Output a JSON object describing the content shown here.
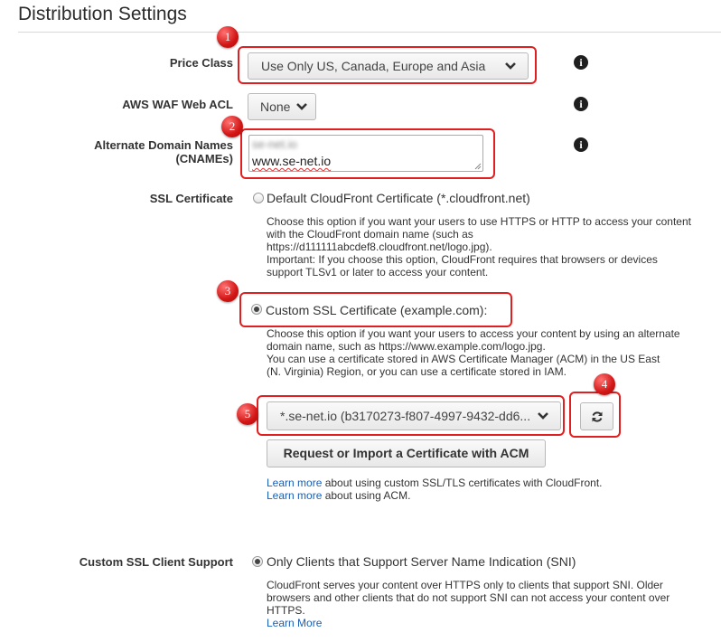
{
  "section": {
    "title": "Distribution Settings"
  },
  "price_class": {
    "label": "Price Class",
    "value": "Use Only US, Canada, Europe and Asia",
    "marker": "1"
  },
  "waf": {
    "label": "AWS WAF Web ACL",
    "value": "None"
  },
  "cnames": {
    "label_line1": "Alternate Domain Names",
    "label_line2": "(CNAMEs)",
    "line1": "se-net.io",
    "line2": "www.se-net.io",
    "marker": "2"
  },
  "ssl": {
    "label": "SSL Certificate",
    "default_option": "Default CloudFront Certificate (*.cloudfront.net)",
    "default_desc": [
      "Choose this option if you want your users to use HTTPS or HTTP to access your content",
      "with the CloudFront domain name (such as",
      "https://d111111abcdef8.cloudfront.net/logo.jpg).",
      "Important: If you choose this option, CloudFront requires that browsers or devices",
      "support TLSv1 or later to access your content."
    ],
    "custom_option": "Custom SSL Certificate (example.com):",
    "custom_marker": "3",
    "custom_desc": [
      "Choose this option if you want your users to access your content by using an alternate",
      "domain name, such as https://www.example.com/logo.jpg.",
      "You can use a certificate stored in AWS Certificate Manager (ACM) in the US East",
      "(N. Virginia) Region, or you can use a certificate stored in IAM."
    ],
    "cert_select": "*.se-net.io (b3170273-f807-4997-9432-dd6...",
    "cert_marker": "5",
    "refresh_marker": "4",
    "request_button": "Request or Import a Certificate with ACM",
    "learn1_link": "Learn more",
    "learn1_text": " about using custom SSL/TLS certificates with CloudFront.",
    "learn2_link": "Learn more",
    "learn2_text": " about using ACM."
  },
  "client_support": {
    "label": "Custom SSL Client Support",
    "option": "Only Clients that Support Server Name Indication (SNI)",
    "desc": [
      "CloudFront serves your content over HTTPS only to clients that support SNI. Older",
      "browsers and other clients that do not support SNI can not access your content over",
      "HTTPS."
    ],
    "learn_link": "Learn More"
  },
  "icons": {
    "info": "info-icon",
    "chevron": "chevron-down-icon",
    "refresh": "refresh-icon"
  },
  "colors": {
    "annotation_red": "#e02020",
    "link": "#1a5fb4"
  }
}
